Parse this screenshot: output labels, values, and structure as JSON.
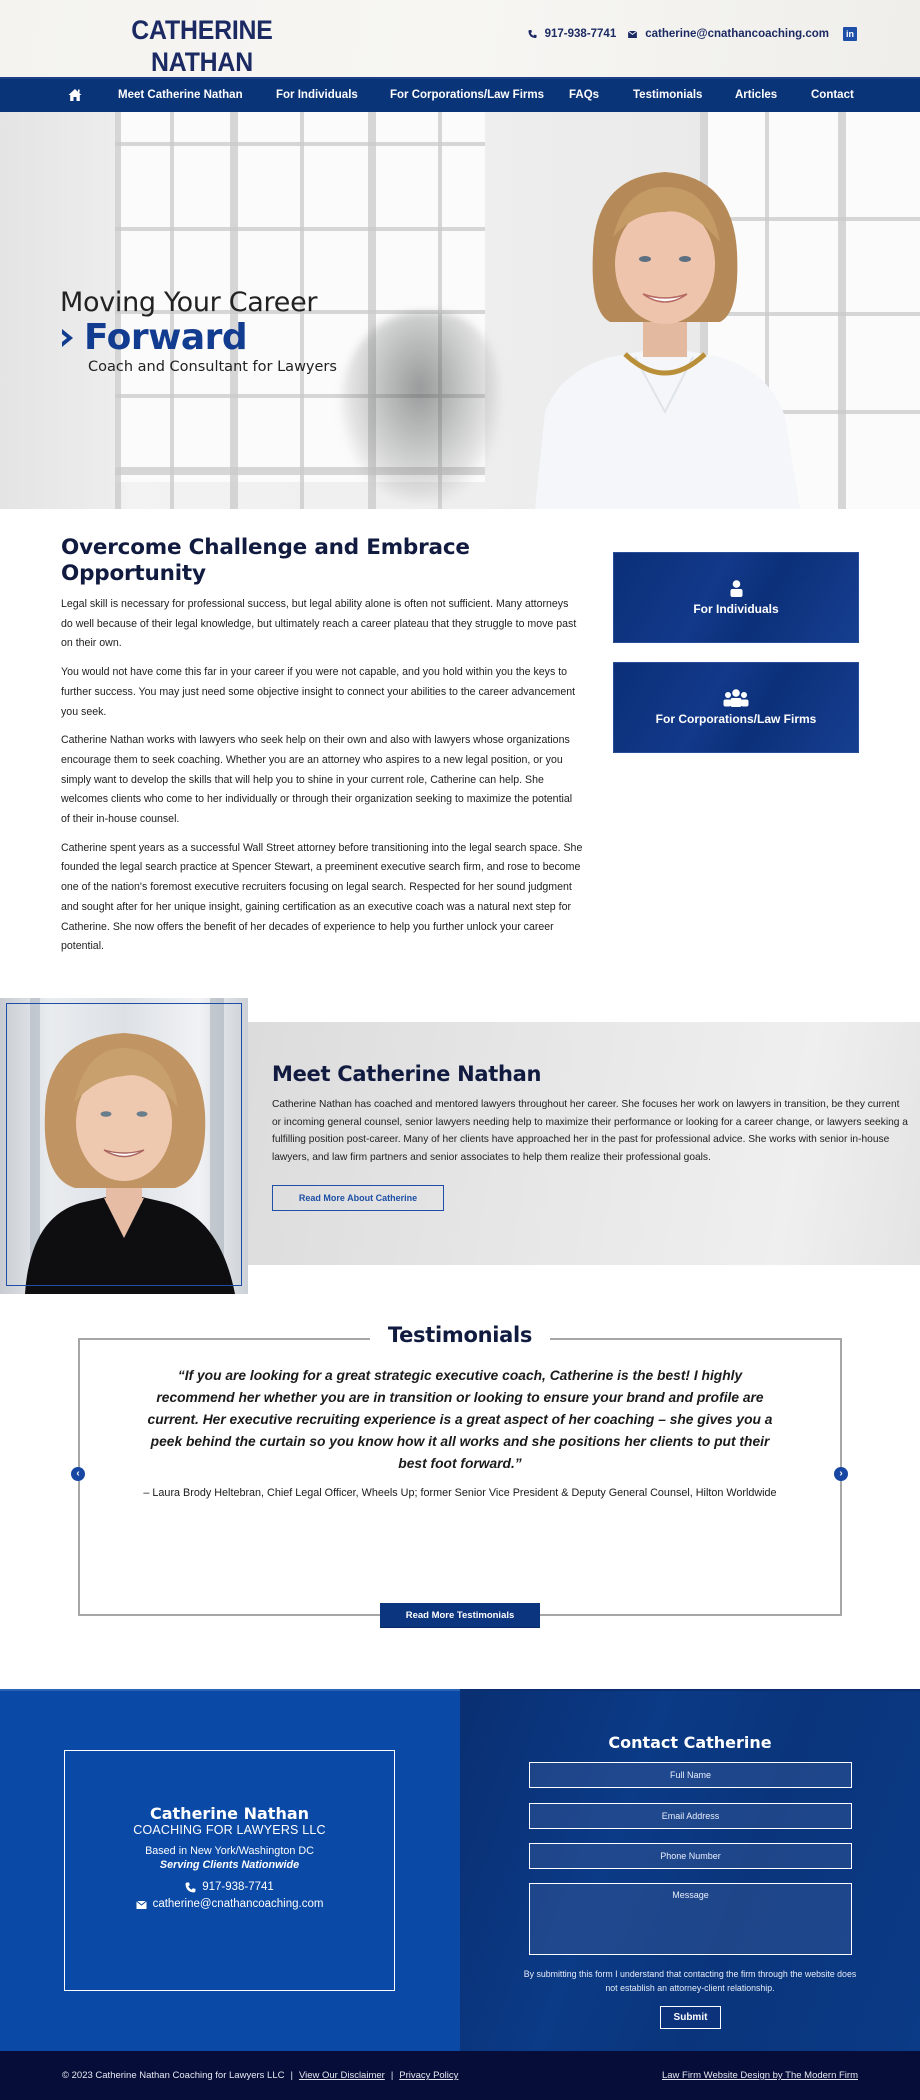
{
  "header": {
    "logo_name": "CATHERINE NATHAN",
    "logo_sub": "COACHING FOR LAWYERS LLC",
    "phone": "917-938-7741",
    "email": "catherine@cnathancoaching.com",
    "linkedin_label": "in",
    "icons": {
      "phone": "phone-icon",
      "email": "envelope-icon",
      "linkedin": "linkedin-icon"
    }
  },
  "nav": {
    "home_icon": "home-icon",
    "items": [
      {
        "label": "Meet Catherine Nathan"
      },
      {
        "label": "For Individuals"
      },
      {
        "label": "For Corporations/Law Firms"
      },
      {
        "label": "FAQs"
      },
      {
        "label": "Testimonials"
      },
      {
        "label": "Articles"
      },
      {
        "label": "Contact"
      }
    ]
  },
  "hero": {
    "line1": "Moving Your Career",
    "line2": "Forward",
    "line3": "Coach and Consultant for Lawyers",
    "accent_color": "#123c8f"
  },
  "intro": {
    "heading": "Overcome Challenge and Embrace Opportunity",
    "paragraphs": [
      "Legal skill is necessary for professional success, but legal ability alone is often not sufficient. Many attorneys do well because of their legal knowledge, but ultimately reach a career plateau that they struggle to move past on their own.",
      "You would not have come this far in your career if you were not capable, and you hold within you the keys to further success. You may just need some objective insight to connect your abilities to the career advancement you seek.",
      "Catherine Nathan works with lawyers who seek help on their own and also with lawyers whose organizations encourage them to seek coaching. Whether you are an attorney who aspires to a new legal position, or you simply want to develop the skills that will help you to shine in your current role, Catherine can help. She welcomes clients who come to her individually or through their organization seeking to maximize the potential of their in-house counsel.",
      "Catherine spent years as a successful Wall Street attorney before transitioning into the legal search space. She founded the legal search practice at Spencer Stewart, a preeminent executive search firm, and rose to become one of the nation's foremost executive recruiters focusing on legal search. Respected for her sound judgment and sought after for her unique insight, gaining certification as an executive coach was a natural next step for Catherine. She now offers the benefit of her decades of experience to help you further unlock your career potential."
    ]
  },
  "services": [
    {
      "label": "For Individuals",
      "icon": "user-icon"
    },
    {
      "label": "For Corporations/Law Firms",
      "icon": "users-group-icon"
    }
  ],
  "meet": {
    "heading": "Meet Catherine Nathan",
    "body": "Catherine Nathan has coached and mentored lawyers throughout her career. She focuses her work on lawyers in transition, be they current or incoming general counsel, senior lawyers needing help to maximize their performance or looking for a career change, or lawyers seeking a fulfilling position post-career. Many of her clients have approached her in the past for professional advice. She works with senior in-house lawyers, and law firm partners and senior associates to help them realize their professional goals.",
    "button": "Read More About Catherine"
  },
  "testimonials": {
    "heading": "Testimonials",
    "quote": "“If you are looking for a great strategic executive coach, Catherine is the best! I highly recommend her whether you are in transition or looking to ensure your brand and profile are current. Her executive recruiting experience is a great aspect of her coaching – she gives you a peek behind the curtain so you know how it all works and she positions her clients to put their best foot forward.”",
    "author": "– Laura Brody Heltebran, Chief Legal Officer, Wheels Up; former Senior Vice President & Deputy General Counsel, Hilton Worldwide",
    "prev_label": "‹",
    "next_label": "›",
    "more_button": "Read More Testimonials"
  },
  "footer_card": {
    "name": "Catherine Nathan",
    "company": "COACHING FOR LAWYERS LLC",
    "location": "Based in New York/Washington DC",
    "serving": "Serving Clients Nationwide",
    "phone": "917-938-7741",
    "email": "catherine@cnathancoaching.com"
  },
  "contact_form": {
    "heading": "Contact Catherine",
    "fields": {
      "name_placeholder": "Full Name",
      "email_placeholder": "Email Address",
      "phone_placeholder": "Phone Number",
      "message_placeholder": "Message"
    },
    "disclaimer": "By submitting this form I understand that contacting the firm through the website does not establish an attorney-client relationship.",
    "submit": "Submit"
  },
  "bottom_bar": {
    "copyright": "© 2023 Catherine Nathan Coaching for Lawyers LLC",
    "sep": "|",
    "disclaimer_link": "View Our Disclaimer",
    "privacy_link": "Privacy Policy",
    "credit_link": "Law Firm Website Design by The Modern Firm"
  },
  "colors": {
    "navy": "#0a3478",
    "heading": "#111a3f",
    "footer_left": "#0a4aa6",
    "footer_right": "#0b3a86",
    "bottom_bar": "#060d38"
  }
}
